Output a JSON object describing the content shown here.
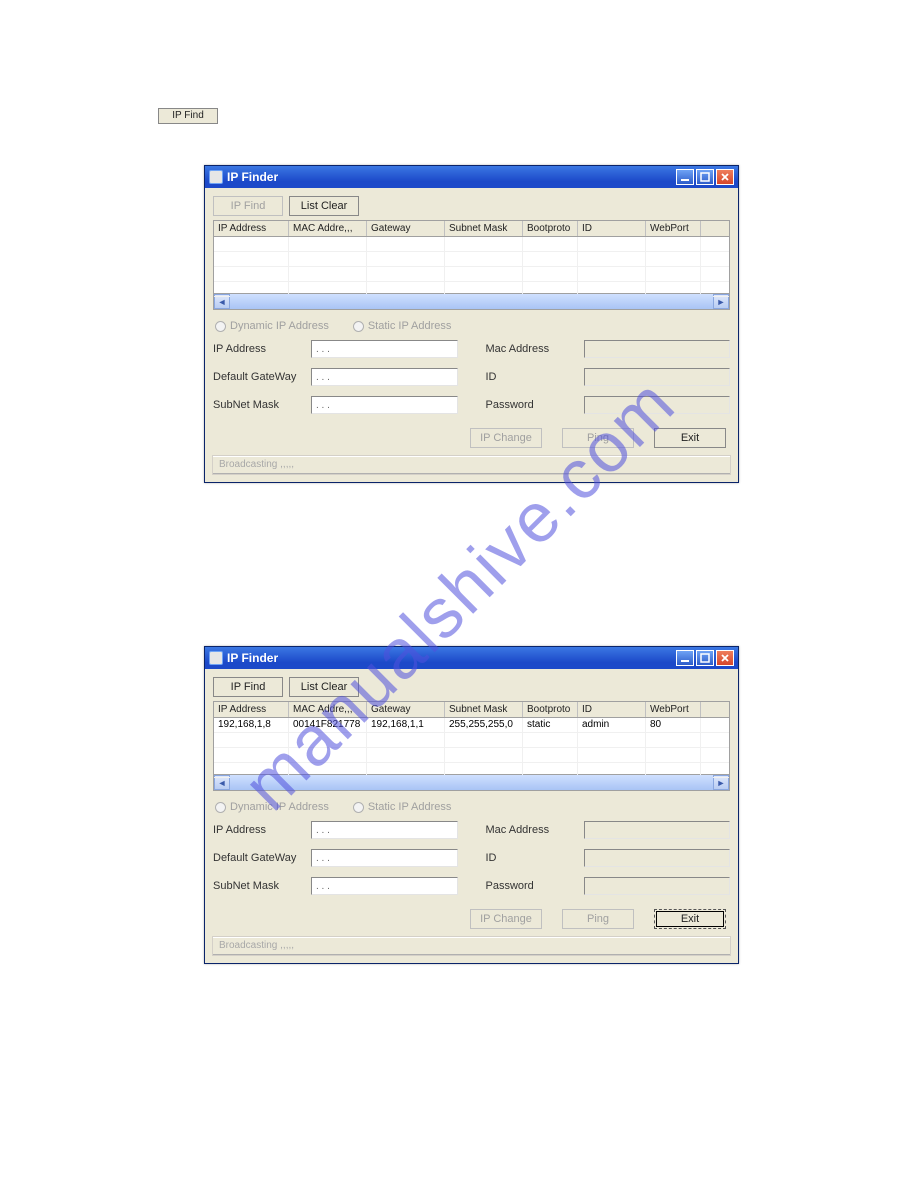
{
  "watermark_text": "manualshive.com",
  "external_button_label": "IP Find",
  "window": {
    "title": "IP Finder",
    "toolbar": {
      "ip_find": "IP Find",
      "list_clear": "List Clear"
    },
    "grid_headers": {
      "ip": "IP Address",
      "mac": "MAC Addre,,,",
      "gateway": "Gateway",
      "subnet": "Subnet Mask",
      "bootproto": "Bootproto",
      "id": "ID",
      "webport": "WebPort"
    },
    "radios": {
      "dynamic": "Dynamic IP Address",
      "static": "Static IP Address"
    },
    "form": {
      "ip_label": "IP Address",
      "gw_label": "Default GateWay",
      "sub_label": "SubNet Mask",
      "mac_label": "Mac Address",
      "id_label": "ID",
      "pw_label": "Password",
      "dotted_placeholder": ".       .       ."
    },
    "actions": {
      "ip_change": "IP Change",
      "ping": "Ping",
      "exit": "Exit"
    },
    "status": "Broadcasting ,,,,,"
  },
  "window2_row": {
    "ip": "192,168,1,8",
    "mac": "00141F821778",
    "gateway": "192,168,1,1",
    "subnet": "255,255,255,0",
    "bootproto": "static",
    "id": "admin",
    "webport": "80"
  }
}
